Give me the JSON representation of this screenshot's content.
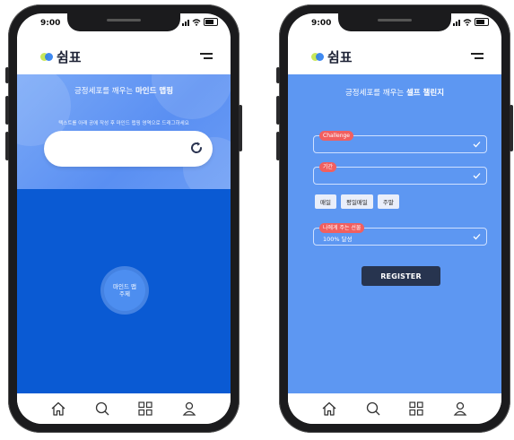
{
  "left_screen": {
    "status_time": "9:00",
    "logo_text": "쉼표",
    "hero_title_prefix": "긍정세포를 깨우는 ",
    "hero_title_bold": "마인드 맵핑",
    "hero_subtitle": "텍스트를 아래 공에 작성 후 마인드 맵핑 영역으로 드래그하세요",
    "map_node_label": "마인드 맵 주제"
  },
  "right_screen": {
    "status_time": "9:00",
    "logo_text": "쉼표",
    "form_title_prefix": "긍정세포를 깨우는 ",
    "form_title_bold": "셀프 챌린지",
    "fields": [
      {
        "label": "Challenge",
        "value": ""
      },
      {
        "label": "기간",
        "value": ""
      },
      {
        "label": "나에게 주는 선물",
        "value": "100% 달성"
      }
    ],
    "period_chips": [
      "매일",
      "평일매일",
      "주말"
    ],
    "register_label": "REGISTER"
  },
  "bottom_nav": [
    "home-icon",
    "search-icon",
    "grid-icon",
    "profile-icon"
  ],
  "colors": {
    "hero_blue": "#6a9cf5",
    "map_blue": "#0a5ad3",
    "form_blue": "#5d97f2",
    "label_red": "#f15f5f",
    "button_navy": "#27344f"
  }
}
